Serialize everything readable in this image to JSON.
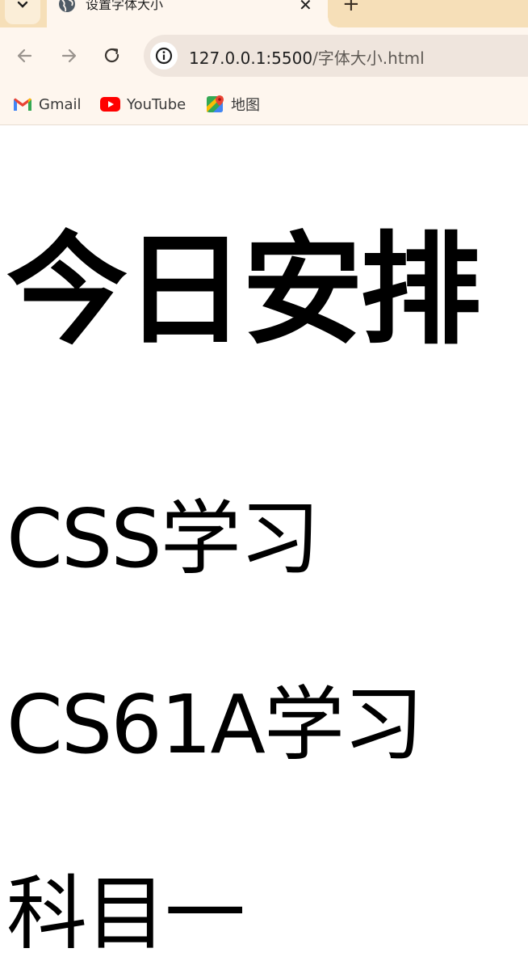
{
  "browser": {
    "tab": {
      "title": "设置字体大小",
      "close_label": "✕"
    },
    "new_tab_label": "+",
    "address_bar": {
      "host": "127.0.0.1:5500",
      "path": "/字体大小.html"
    },
    "bookmarks": [
      {
        "label": "Gmail",
        "icon": "gmail-icon"
      },
      {
        "label": "YouTube",
        "icon": "youtube-icon"
      },
      {
        "label": "地图",
        "icon": "maps-icon"
      }
    ]
  },
  "page": {
    "heading": "今日安排",
    "lines": [
      "CSS学习",
      "CS61A学习",
      "科目一"
    ]
  }
}
